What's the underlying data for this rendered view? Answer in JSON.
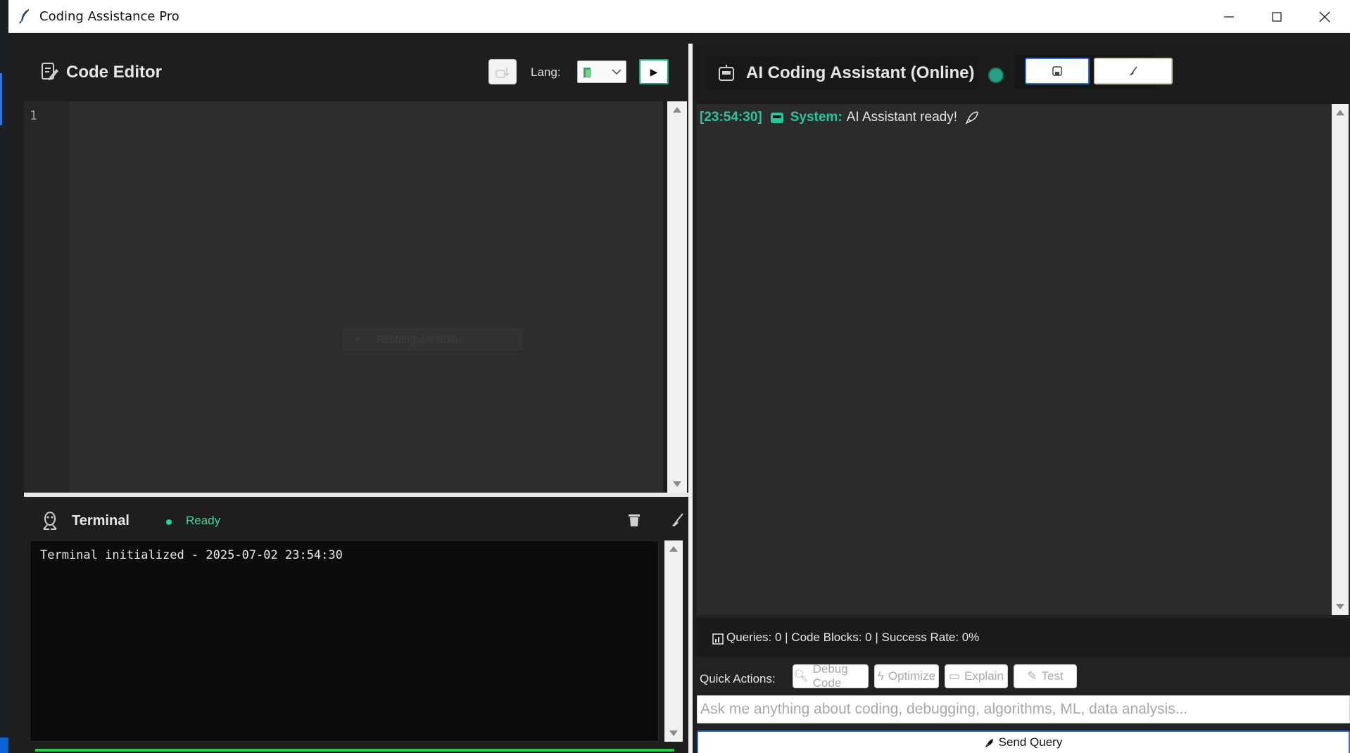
{
  "window": {
    "title": "Coding Assistance Pro",
    "controls": [
      "minimize-icon",
      "maximize-icon",
      "close-icon"
    ]
  },
  "editor": {
    "title": "Code Editor",
    "icon": "edit-document-icon",
    "lang_label": "Lang:",
    "line_numbers": [
      "1"
    ],
    "code": "",
    "overlay_text": "Rectangular Snip",
    "toolbar_icons": [
      "download-icon",
      "language-icon",
      "play-icon"
    ],
    "run_label": "▶"
  },
  "terminal": {
    "title": "Terminal",
    "icon": "linux-tux-icon",
    "status": "Ready",
    "status_color": "#41d69a",
    "output": "Terminal initialized - 2025-07-02 23:54:30",
    "action_icons": [
      "trash-icon",
      "broom-icon"
    ]
  },
  "assistant": {
    "title": "AI Coding Assistant (Online)",
    "icon": "robot-icon",
    "status_icon": "globe-icon",
    "header_buttons": [
      "save-icon",
      "broom-icon"
    ],
    "messages": [
      {
        "time": "[23:54:30]",
        "sender": "System:",
        "text": "AI Assistant ready!",
        "icons": [
          "robot-icon",
          "rocket-icon"
        ]
      }
    ],
    "stats": "Queries: 0 | Code Blocks: 0 | Success Rate: 0%",
    "stats_icon": "bar-chart-icon",
    "quick_actions_label": "Quick Actions:",
    "quick_actions": [
      {
        "label": "Debug Code",
        "icon": "search-icon"
      },
      {
        "label": "Optimize",
        "icon": "lightning-icon"
      },
      {
        "label": "Explain",
        "icon": "book-icon"
      },
      {
        "label": "Test",
        "icon": "test-tube-icon"
      }
    ],
    "input_placeholder": "Ask me anything about coding, debugging, algorithms, ML, data analysis...",
    "input_value": "",
    "send_label": "Send Query",
    "send_icon": "rocket-icon"
  },
  "colors": {
    "accent_green": "#2bc59a",
    "progress_green": "#17d63b",
    "send_border": "#2f6fd0"
  }
}
